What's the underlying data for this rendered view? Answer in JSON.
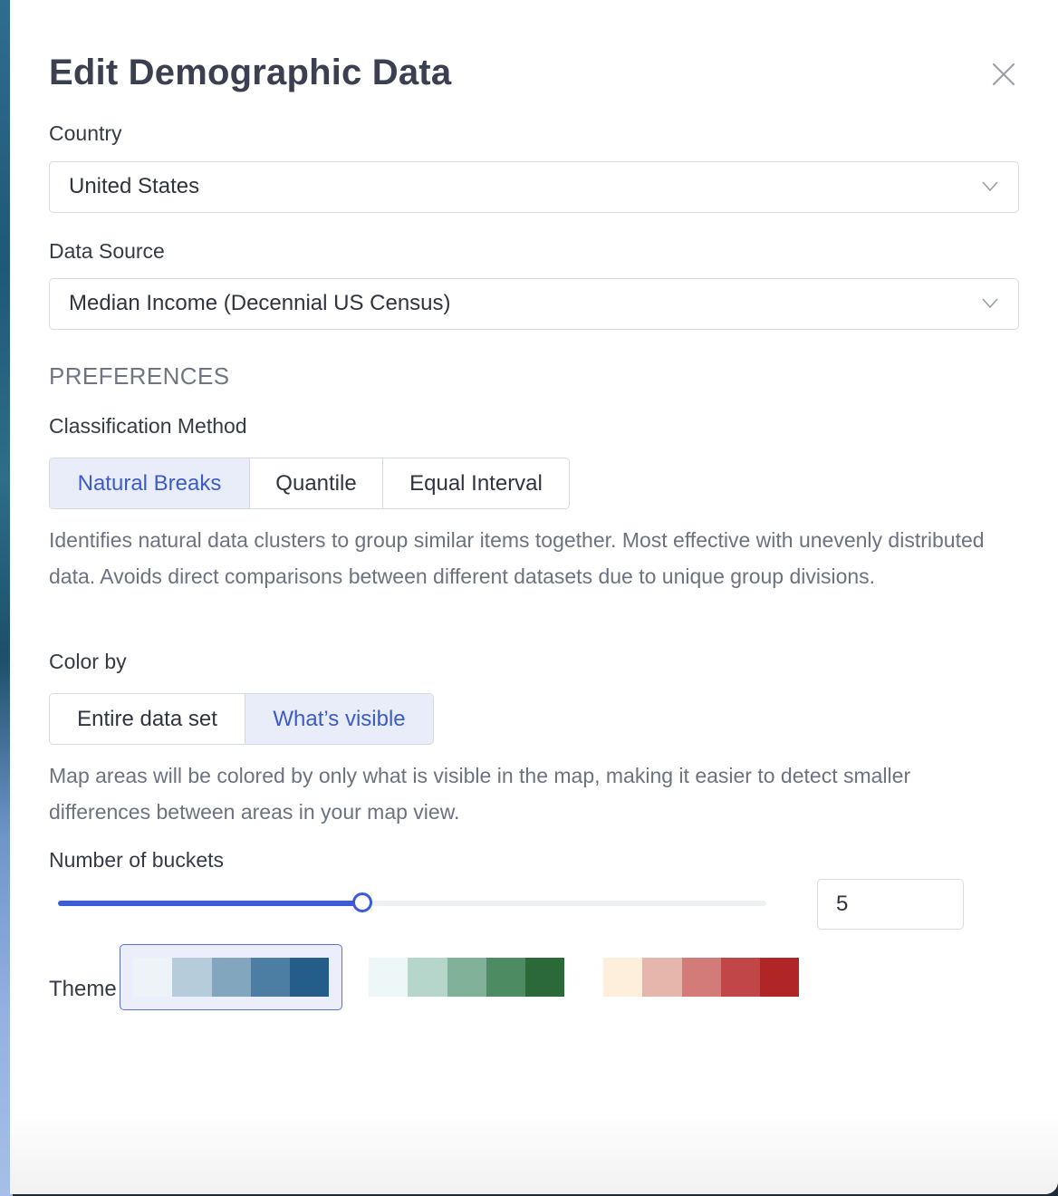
{
  "dialog": {
    "title": "Edit Demographic Data"
  },
  "country": {
    "label": "Country",
    "value": "United States"
  },
  "data_source": {
    "label": "Data Source",
    "value": "Median Income (Decennial US Census)"
  },
  "preferences": {
    "heading": "PREFERENCES"
  },
  "classification": {
    "label": "Classification Method",
    "options": [
      "Natural Breaks",
      "Quantile",
      "Equal Interval"
    ],
    "selected": "Natural Breaks",
    "description": "Identifies natural data clusters to group similar items together. Most effective with unevenly distributed data. Avoids direct comparisons between different datasets due to unique group divisions."
  },
  "color_by": {
    "label": "Color by",
    "options": [
      "Entire data set",
      "What’s visible"
    ],
    "selected": "What’s visible",
    "description": "Map areas will be colored by only what is visible in the map, making it easier to detect smaller differences between areas in your map view."
  },
  "buckets": {
    "label": "Number of buckets",
    "value": "5",
    "slider_fraction": 0.43
  },
  "theme": {
    "label": "Theme",
    "selected_index": 0,
    "palettes": [
      {
        "name": "blue",
        "colors": [
          "#eef3f8",
          "#b7ccda",
          "#82a6bd",
          "#4c7ea3",
          "#245d8a"
        ]
      },
      {
        "name": "green",
        "colors": [
          "#edf7f8",
          "#b6d6cb",
          "#82b199",
          "#4d8b63",
          "#2c6939"
        ]
      },
      {
        "name": "red",
        "colors": [
          "#fdefdc",
          "#e6b5ab",
          "#d37b78",
          "#c14648",
          "#b02626"
        ]
      }
    ]
  },
  "colors": {
    "accent": "#3c5bd8",
    "active_bg": "#e9edf9"
  }
}
